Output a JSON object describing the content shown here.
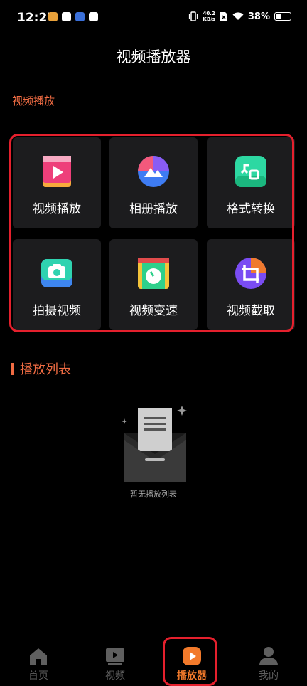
{
  "status_bar": {
    "time": "12:27",
    "net_speed_value": "40.2",
    "net_speed_unit": "KB/s",
    "battery": "38%"
  },
  "page_title": "视频播放器",
  "section_label": "视频播放",
  "tools": [
    {
      "label": "视频播放",
      "icon": "video-play-icon"
    },
    {
      "label": "相册播放",
      "icon": "album-play-icon"
    },
    {
      "label": "格式转换",
      "icon": "format-convert-icon"
    },
    {
      "label": "拍摄视频",
      "icon": "camera-icon"
    },
    {
      "label": "视频变速",
      "icon": "video-speed-icon"
    },
    {
      "label": "视频截取",
      "icon": "video-crop-icon"
    }
  ],
  "playlist": {
    "title": "播放列表",
    "empty_text": "暂无播放列表"
  },
  "bottom_nav": [
    {
      "label": "首页",
      "icon": "home-icon",
      "active": false
    },
    {
      "label": "视频",
      "icon": "video-icon",
      "active": false
    },
    {
      "label": "播放器",
      "icon": "player-icon",
      "active": true
    },
    {
      "label": "我的",
      "icon": "profile-icon",
      "active": false
    }
  ],
  "colors": {
    "accent": "#f06c43",
    "highlight_frame": "#e5202d",
    "tile_bg": "#1c1c1e",
    "nav_active": "#f27a2b"
  }
}
